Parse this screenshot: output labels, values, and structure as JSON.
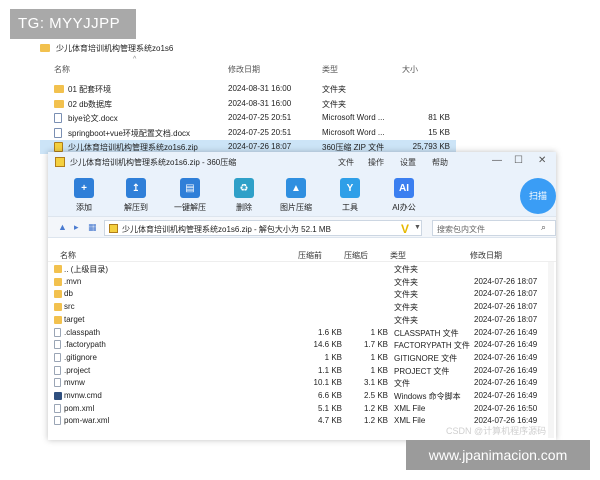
{
  "overlay": {
    "tag": "TG: MYYJJPP",
    "site": "www.jpanimacion.com",
    "csdn": "CSDN @计算机程序源码"
  },
  "explorer": {
    "path": "少儿体育培训机构管理系统zo1s6",
    "columns": {
      "name": "名称",
      "modified": "修改日期",
      "type": "类型",
      "size": "大小"
    },
    "rows": [
      {
        "name": "01 配套环境",
        "modified": "2024-08-31 16:00",
        "type": "文件夹",
        "size": "",
        "icon": "folder-icon"
      },
      {
        "name": "02 db数据库",
        "modified": "2024-08-31 16:00",
        "type": "文件夹",
        "size": "",
        "icon": "folder-icon"
      },
      {
        "name": "biye论文.docx",
        "modified": "2024-07-25 20:51",
        "type": "Microsoft Word ...",
        "size": "81 KB",
        "icon": "word-doc-icon"
      },
      {
        "name": "springboot+vue环境配置文档.docx",
        "modified": "2024-07-25 20:51",
        "type": "Microsoft Word ...",
        "size": "15 KB",
        "icon": "word-doc-icon"
      },
      {
        "name": "少儿体育培训机构管理系统zo1s6.zip",
        "modified": "2024-07-26 18:07",
        "type": "360压缩 ZIP 文件",
        "size": "25,793 KB",
        "icon": "zip-icon"
      }
    ]
  },
  "win": {
    "title": "少儿体育培训机构管理系统zo1s6.zip - 360压缩",
    "menu": {
      "file": "文件",
      "ops": "操作",
      "settings": "设置",
      "help": "帮助"
    },
    "controls": {
      "min": "—",
      "max": "☐",
      "close": "✕"
    },
    "tools": {
      "add": "添加",
      "extract": "解压到",
      "one_click": "一键解压",
      "delete": "删除",
      "img_compress": "图片压缩",
      "tools": "工具",
      "ai": "AI办公"
    },
    "icon_text": {
      "ai": "AI"
    },
    "scan": "扫描",
    "address": "少儿体育培训机构管理系统zo1s6.zip - 解包大小为 52.1 MB",
    "search_placeholder": "搜索包内文件",
    "columns": {
      "name": "名称",
      "compressed": "压缩前",
      "size": "压缩后",
      "type": "类型",
      "modified": "修改日期"
    },
    "rows": [
      {
        "name": ".. (上级目录)",
        "compressed": "",
        "size": "",
        "type": "文件夹",
        "modified": "",
        "icon": "folder-icon"
      },
      {
        "name": ".mvn",
        "compressed": "",
        "size": "",
        "type": "文件夹",
        "modified": "2024-07-26 18:07",
        "icon": "folder-icon"
      },
      {
        "name": "db",
        "compressed": "",
        "size": "",
        "type": "文件夹",
        "modified": "2024-07-26 18:07",
        "icon": "folder-icon"
      },
      {
        "name": "src",
        "compressed": "",
        "size": "",
        "type": "文件夹",
        "modified": "2024-07-26 18:07",
        "icon": "folder-icon"
      },
      {
        "name": "target",
        "compressed": "",
        "size": "",
        "type": "文件夹",
        "modified": "2024-07-26 18:07",
        "icon": "folder-icon"
      },
      {
        "name": ".classpath",
        "compressed": "1.6 KB",
        "size": "1 KB",
        "type": "CLASSPATH 文件",
        "modified": "2024-07-26 16:49",
        "icon": "file-icon"
      },
      {
        "name": ".factorypath",
        "compressed": "14.6 KB",
        "size": "1.7 KB",
        "type": "FACTORYPATH 文件",
        "modified": "2024-07-26 16:49",
        "icon": "file-icon"
      },
      {
        "name": ".gitignore",
        "compressed": "1 KB",
        "size": "1 KB",
        "type": "GITIGNORE 文件",
        "modified": "2024-07-26 16:49",
        "icon": "file-icon"
      },
      {
        "name": ".project",
        "compressed": "1.1 KB",
        "size": "1 KB",
        "type": "PROJECT 文件",
        "modified": "2024-07-26 16:49",
        "icon": "file-icon"
      },
      {
        "name": "mvnw",
        "compressed": "10.1 KB",
        "size": "3.1 KB",
        "type": "文件",
        "modified": "2024-07-26 16:49",
        "icon": "file-icon"
      },
      {
        "name": "mvnw.cmd",
        "compressed": "6.6 KB",
        "size": "2.5 KB",
        "type": "Windows 命令脚本",
        "modified": "2024-07-26 16:49",
        "icon": "cmd-icon"
      },
      {
        "name": "pom.xml",
        "compressed": "5.1 KB",
        "size": "1.2 KB",
        "type": "XML File",
        "modified": "2024-07-26 16:50",
        "icon": "file-icon"
      },
      {
        "name": "pom-war.xml",
        "compressed": "4.7 KB",
        "size": "1.2 KB",
        "type": "XML File",
        "modified": "2024-07-26 16:49",
        "icon": "file-icon"
      }
    ]
  }
}
